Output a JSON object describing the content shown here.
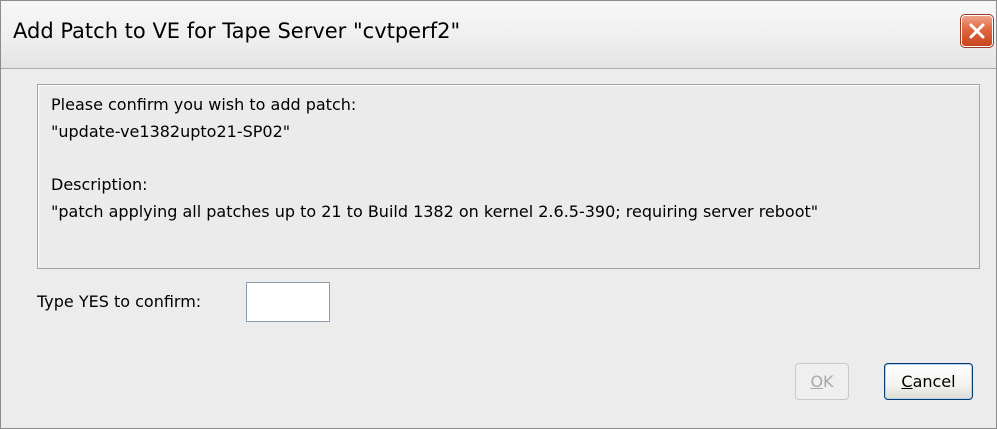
{
  "dialog": {
    "title": "Add Patch to VE for Tape Server \"cvtperf2\"",
    "close_icon": "close-icon"
  },
  "message": {
    "confirm_line": "Please confirm you wish to add patch:",
    "patch_name": "\"update-ve1382upto21-SP02\"",
    "description_label": "Description:",
    "description": "\"patch applying all patches up to 21 to Build 1382 on kernel 2.6.5-390; requiring server reboot\""
  },
  "confirm": {
    "label": "Type YES to confirm:",
    "value": "",
    "placeholder": ""
  },
  "buttons": {
    "ok_mnemonic": "O",
    "ok_rest": "K",
    "ok_enabled": false,
    "cancel_mnemonic": "C",
    "cancel_rest": "ancel"
  },
  "colors": {
    "close_button": "#d9532c",
    "window_background": "#ececec"
  }
}
